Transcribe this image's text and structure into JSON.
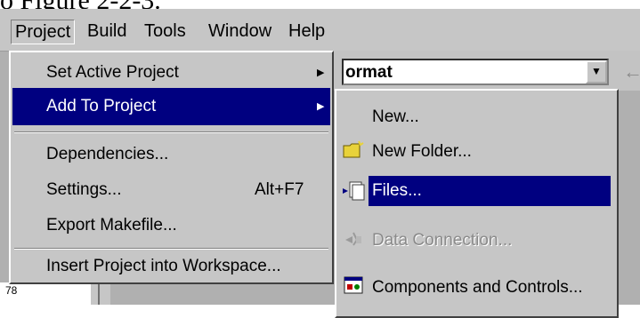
{
  "caption": "o Figure 2-2-3.",
  "menubar": {
    "items": [
      "Project",
      "Build",
      "Tools",
      "Window",
      "Help"
    ]
  },
  "toolbar": {
    "combo_value": "ormat",
    "back_arrow": "←"
  },
  "project_menu": {
    "items": [
      {
        "label": "Set Active Project",
        "accel": "",
        "submenu": true
      },
      {
        "label": "Add To Project",
        "accel": "",
        "submenu": true
      },
      {
        "label": "Dependencies...",
        "accel": "",
        "submenu": false
      },
      {
        "label": "Settings...",
        "accel": "Alt+F7",
        "submenu": false
      },
      {
        "label": "Export Makefile...",
        "accel": "",
        "submenu": false
      },
      {
        "label": "Insert Project into Workspace...",
        "accel": "",
        "submenu": false
      }
    ]
  },
  "submenu": {
    "items": [
      {
        "label": "New...",
        "icon": "none",
        "state": "normal"
      },
      {
        "label": "New Folder...",
        "icon": "folder-icon",
        "state": "normal"
      },
      {
        "label": "Files...",
        "icon": "files-icon",
        "state": "highlighted"
      },
      {
        "label": "Data Connection...",
        "icon": "data-connection-icon",
        "state": "disabled"
      },
      {
        "label": "Components and Controls...",
        "icon": "components-icon",
        "state": "normal"
      }
    ]
  },
  "workspace": {
    "fragment": "78"
  },
  "colors": {
    "highlight": "#000080",
    "menu_bg": "#c6c6c6"
  }
}
